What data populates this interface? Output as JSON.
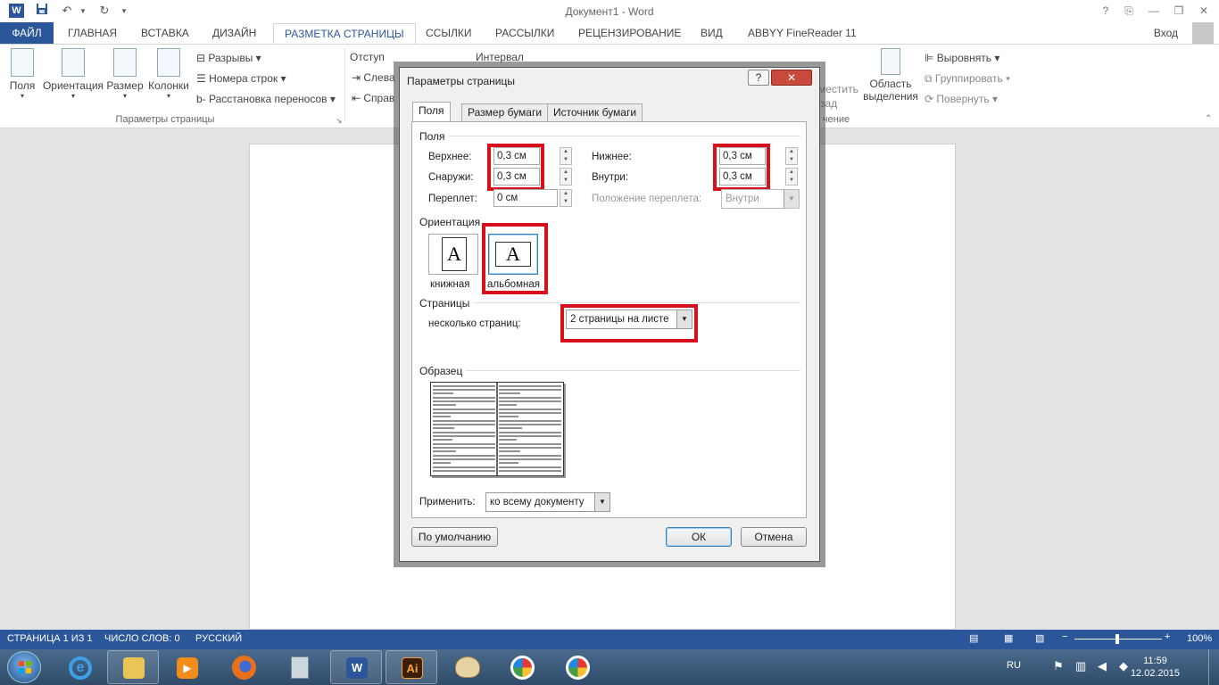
{
  "window": {
    "title": "Документ1 - Word"
  },
  "quick_access": {
    "save_icon": "save-icon",
    "undo_icon": "undo-icon",
    "redo_icon": "redo-icon"
  },
  "window_controls": {
    "help": "?",
    "restore_ribbon": "⎘",
    "minimize": "—",
    "maximize": "❐",
    "close": "✕"
  },
  "tabs": {
    "file": "ФАЙЛ",
    "items": [
      "ГЛАВНАЯ",
      "ВСТАВКА",
      "ДИЗАЙН",
      "РАЗМЕТКА СТРАНИЦЫ",
      "ССЫЛКИ",
      "РАССЫЛКИ",
      "РЕЦЕНЗИРОВАНИЕ",
      "ВИД",
      "ABBYY FineReader 11"
    ],
    "active": "РАЗМЕТКА СТРАНИЦЫ",
    "signin": "Вход"
  },
  "ribbon": {
    "page_setup": {
      "margins": "Поля",
      "orientation": "Ориентация",
      "size": "Размер",
      "columns": "Колонки",
      "breaks": "Разрывы",
      "line_numbers": "Номера строк",
      "hyphenation": "Расстановка переносов",
      "group_label": "Параметры страницы"
    },
    "paragraph": {
      "indent": "Отступ",
      "spacing": "Интервал",
      "left": "Слева",
      "right": "Справ"
    },
    "arrange": {
      "wrap_partial_1": "местить",
      "wrap_partial_2": "зад",
      "group_label_partial": "чение",
      "selection_pane_1": "Область",
      "selection_pane_2": "выделения",
      "align": "Выровнять",
      "group": "Группировать",
      "rotate": "Повернуть"
    }
  },
  "dialog": {
    "title": "Параметры страницы",
    "help": "?",
    "close": "✕",
    "tabs": [
      "Поля",
      "Размер бумаги",
      "Источник бумаги"
    ],
    "margins_section": "Поля",
    "top_label": "Верхнее:",
    "top_value": "0,3 см",
    "bottom_label": "Нижнее:",
    "bottom_value": "0,3 см",
    "outside_label": "Снаружи:",
    "outside_value": "0,3 см",
    "inside_label": "Внутри:",
    "inside_value": "0,3 см",
    "gutter_label": "Переплет:",
    "gutter_value": "0 см",
    "gutter_pos_label": "Положение переплета:",
    "gutter_pos_value": "Внутри",
    "orientation_section": "Ориентация",
    "portrait": "книжная",
    "landscape": "альбомная",
    "orientation_glyph": "A",
    "pages_section": "Страницы",
    "multiple_pages_label": "несколько страниц:",
    "multiple_pages_value": "2 страницы на листе",
    "preview_section": "Образец",
    "apply_label": "Применить:",
    "apply_value": "ко всему документу",
    "default_button": "По умолчанию",
    "ok_button": "ОК",
    "cancel_button": "Отмена"
  },
  "status_bar": {
    "page": "СТРАНИЦА 1 ИЗ 1",
    "words": "ЧИСЛО СЛОВ: 0",
    "language": "РУССКИЙ",
    "zoom": "100%",
    "zoom_level": 1.0
  },
  "taskbar": {
    "lang": "RU",
    "time": "11:59",
    "date": "12.02.2015",
    "apps": [
      "internet-explorer-icon",
      "file-explorer-icon",
      "media-player-icon",
      "firefox-icon",
      "calculator-icon",
      "word-icon",
      "illustrator-icon",
      "paint-icon",
      "picasa-icon",
      "picasa-icon"
    ],
    "ai_label": "Ai",
    "word_label": "W"
  },
  "colors": {
    "accent": "#2b579a",
    "highlight": "#d8101d",
    "taskbar": "#3a5a7c"
  }
}
